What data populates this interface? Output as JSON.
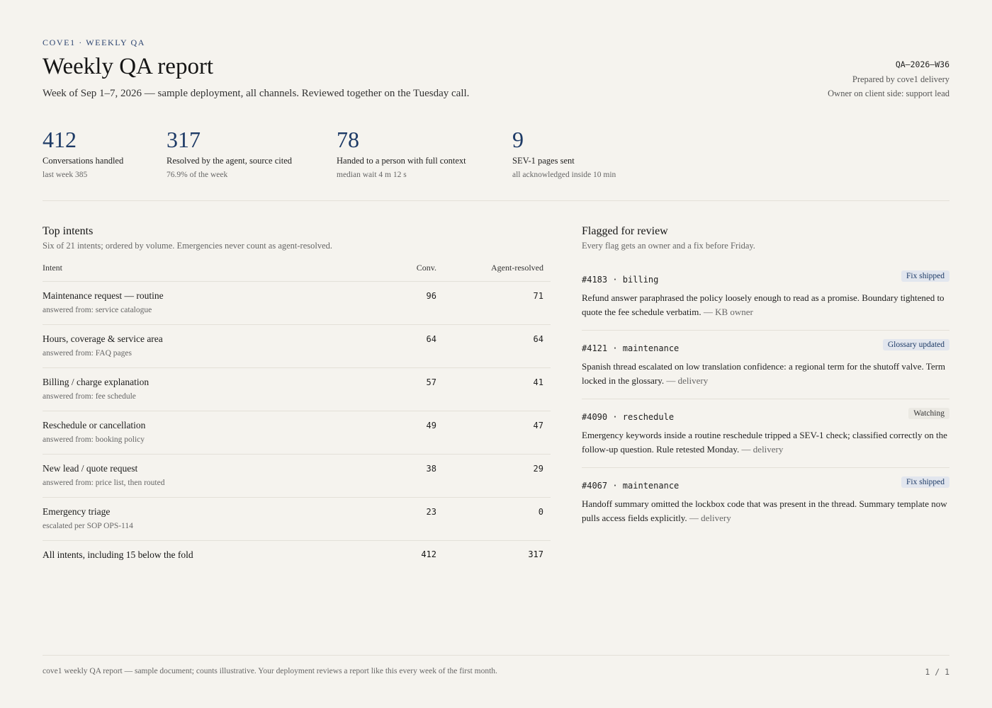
{
  "header": {
    "eyebrow": "COVE1 · WEEKLY QA",
    "title": "Weekly QA report",
    "subtitle": "Week of Sep 1–7, 2026 — sample deployment, all channels. Reviewed together on the Tuesday call.",
    "report_code": "QA–2026–W36",
    "prepared_by": "Prepared by cove1 delivery",
    "owner": "Owner on client side: support lead"
  },
  "stats": [
    {
      "value": "412",
      "label": "Conversations handled",
      "sub": "last week 385"
    },
    {
      "value": "317",
      "label": "Resolved by the agent, source cited",
      "sub": "76.9% of the week"
    },
    {
      "value": "78",
      "label": "Handed to a person with full context",
      "sub": "median wait 4 m 12 s"
    },
    {
      "value": "9",
      "label": "SEV-1 pages sent",
      "sub": "all acknowledged inside 10 min"
    }
  ],
  "intents": {
    "title": "Top intents",
    "subtitle": "Six of 21 intents; ordered by volume. Emergencies never count as agent-resolved.",
    "columns": {
      "intent": "Intent",
      "conv": "Conv.",
      "resolved": "Agent-resolved"
    },
    "rows": [
      {
        "name": "Maintenance request — routine",
        "source": "answered from: service catalogue",
        "conv": "96",
        "resolved": "71"
      },
      {
        "name": "Hours, coverage & service area",
        "source": "answered from: FAQ pages",
        "conv": "64",
        "resolved": "64"
      },
      {
        "name": "Billing / charge explanation",
        "source": "answered from: fee schedule",
        "conv": "57",
        "resolved": "41"
      },
      {
        "name": "Reschedule or cancellation",
        "source": "answered from: booking policy",
        "conv": "49",
        "resolved": "47"
      },
      {
        "name": "New lead / quote request",
        "source": "answered from: price list, then routed",
        "conv": "38",
        "resolved": "29"
      },
      {
        "name": "Emergency triage",
        "source": "escalated per SOP OPS-114",
        "conv": "23",
        "resolved": "0"
      }
    ],
    "total": {
      "name": "All intents, including 15 below the fold",
      "conv": "412",
      "resolved": "317"
    }
  },
  "flags": {
    "title": "Flagged for review",
    "subtitle": "Every flag gets an owner and a fix before Friday.",
    "items": [
      {
        "id": "#4183 · billing",
        "badge": "Fix shipped",
        "body": "Refund answer paraphrased the policy loosely enough to read as a promise. Boundary tightened to quote the fee schedule verbatim.",
        "who": "— KB owner"
      },
      {
        "id": "#4121 · maintenance",
        "badge": "Glossary updated",
        "body": "Spanish thread escalated on low translation confidence: a regional term for the shutoff valve. Term locked in the glossary.",
        "who": "— delivery"
      },
      {
        "id": "#4090 · reschedule",
        "badge": "Watching",
        "body": "Emergency keywords inside a routine reschedule tripped a SEV-1 check; classified correctly on the follow-up question. Rule retested Monday.",
        "who": "— delivery"
      },
      {
        "id": "#4067 · maintenance",
        "badge": "Fix shipped",
        "body": "Handoff summary omitted the lockbox code that was present in the thread. Summary template now pulls access fields explicitly.",
        "who": "— delivery"
      }
    ]
  },
  "footer": {
    "note": "cove1 weekly QA report — sample document; counts illustrative. Your deployment reviews a report like this every week of the first month.",
    "page": "1 / 1"
  }
}
